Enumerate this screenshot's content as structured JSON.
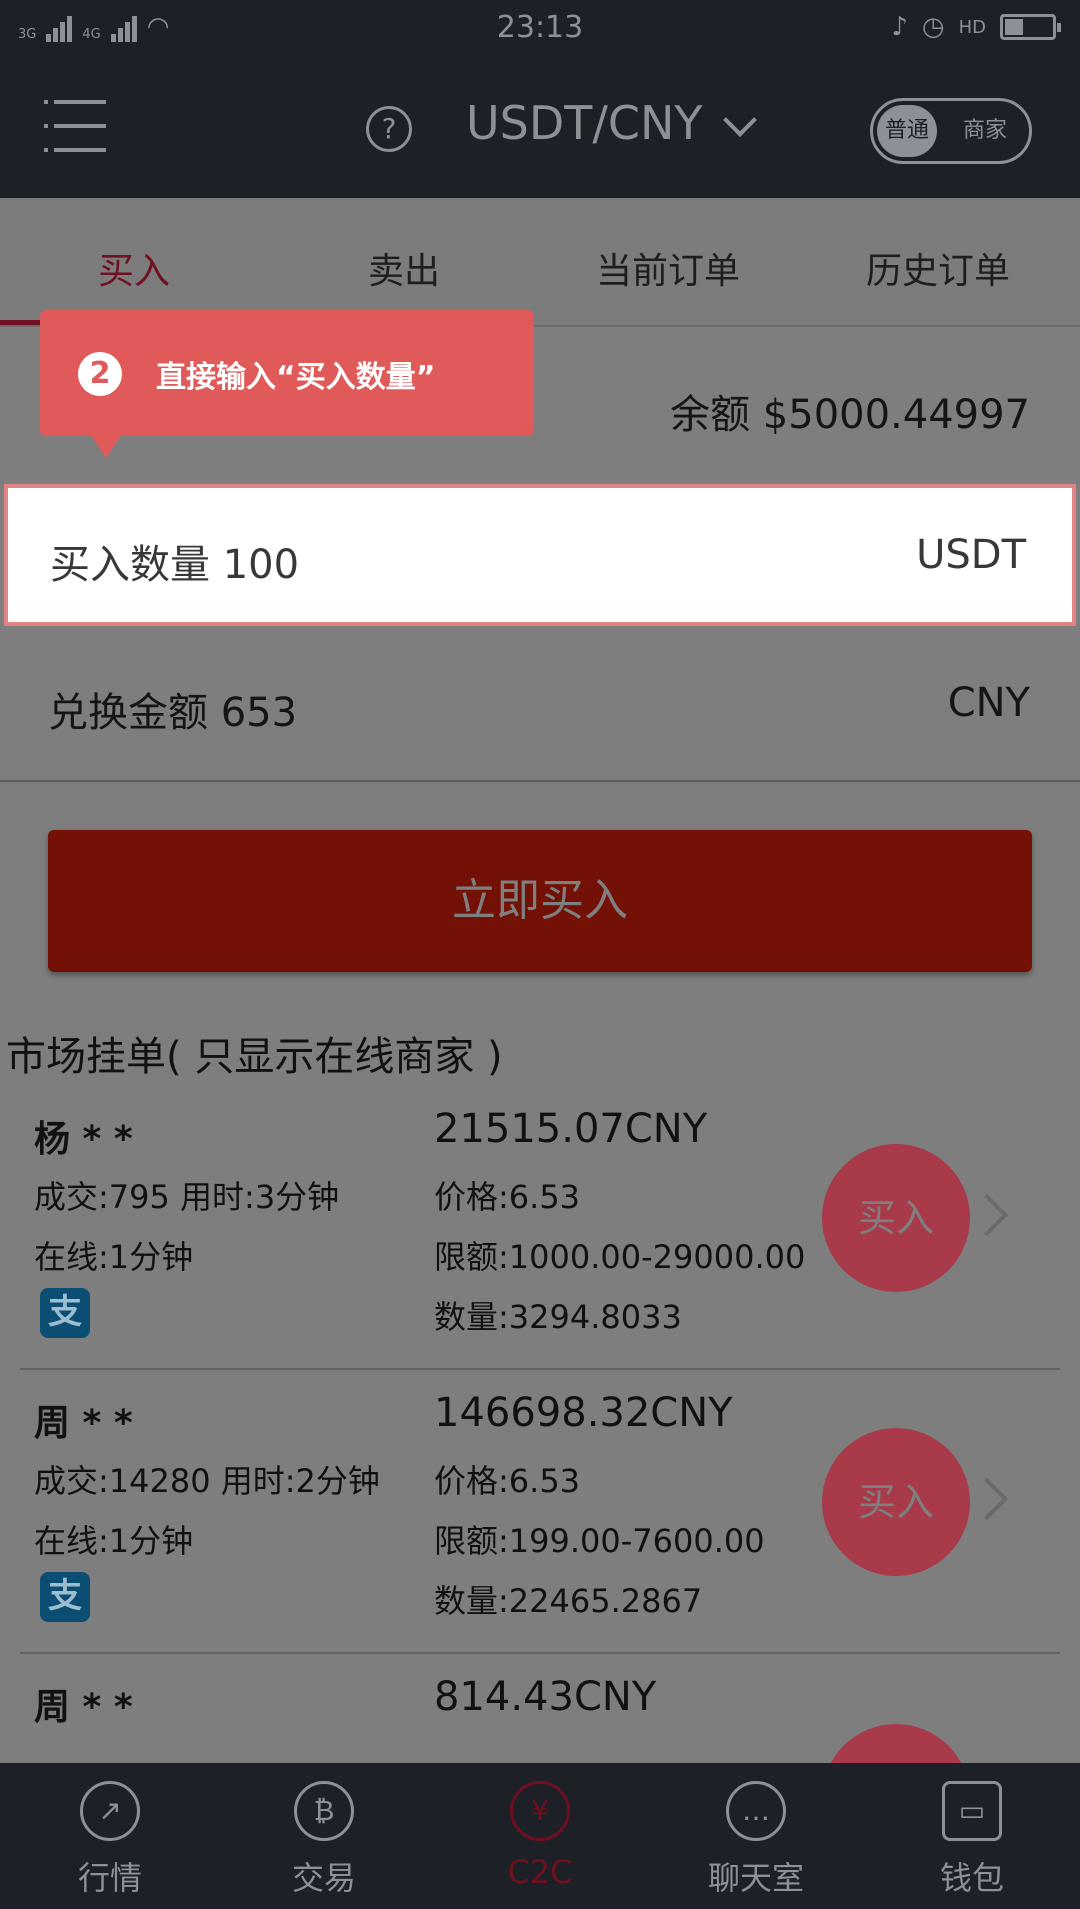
{
  "status_bar": {
    "net1": "3G",
    "net2": "4G",
    "time": "23:13",
    "hd": "HD"
  },
  "header": {
    "title": "USDT/CNY",
    "help_symbol": "?",
    "mode_on": "普通",
    "mode_off": "商家"
  },
  "tabs": [
    {
      "label": "买入"
    },
    {
      "label": "卖出"
    },
    {
      "label": "当前订单"
    },
    {
      "label": "历史订单"
    }
  ],
  "balance": "余额 $5000.44997",
  "quantity": {
    "label": "买入数量 100",
    "unit": "USDT"
  },
  "amount": {
    "label": "兑换金额 653",
    "unit": "CNY"
  },
  "buy_now_label": "立即买入",
  "market_title": "市场挂单( 只显示在线商家 )",
  "tooltip": {
    "step": "2",
    "text": "直接输入“买入数量”"
  },
  "orders": [
    {
      "name": "杨 * *",
      "deal": "成交:795  用时:3分钟",
      "online": "在线:1分钟",
      "pay_icon": "支",
      "total": "21515.07CNY",
      "price": "价格:6.53",
      "limit": "限额:1000.00-29000.00",
      "qty": "数量:3294.8033",
      "buy": "买入"
    },
    {
      "name": "周 * *",
      "deal": "成交:14280  用时:2分钟",
      "online": "在线:1分钟",
      "pay_icon": "支",
      "total": "146698.32CNY",
      "price": "价格:6.53",
      "limit": "限额:199.00-7600.00",
      "qty": "数量:22465.2867",
      "buy": "买入"
    },
    {
      "name": "周 * *",
      "total": "814.43CNY"
    }
  ],
  "bottom_nav": [
    {
      "label": "行情",
      "icon": "trend-icon"
    },
    {
      "label": "交易",
      "icon": "bitcoin-icon"
    },
    {
      "label": "C2C",
      "icon": "yen-icon"
    },
    {
      "label": "聊天室",
      "icon": "chat-icon"
    },
    {
      "label": "钱包",
      "icon": "wallet-icon"
    }
  ],
  "colors": {
    "accent": "#701023",
    "tooltip": "#e05a59",
    "highlight_border": "#e08286",
    "buy_button": "#741106"
  }
}
